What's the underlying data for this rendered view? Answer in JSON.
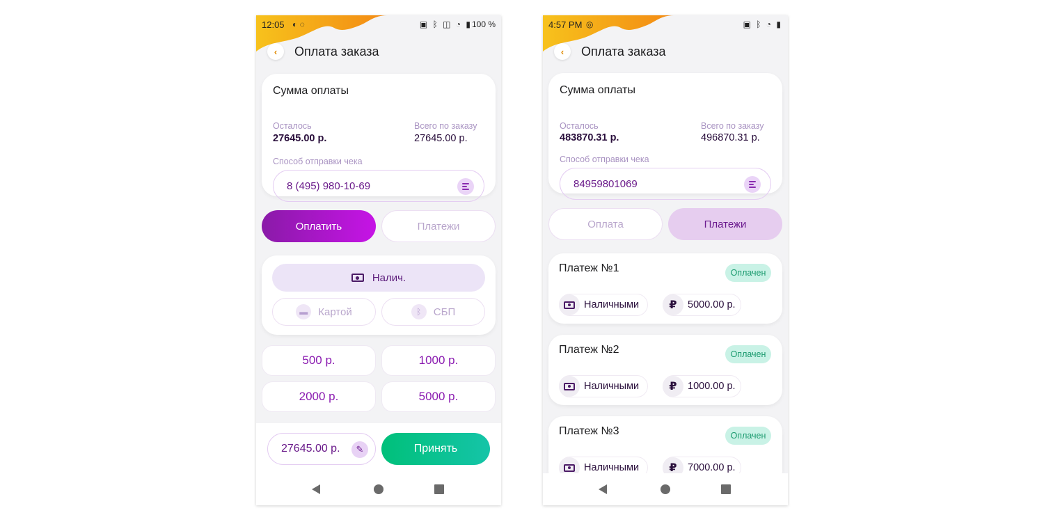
{
  "colors": {
    "accent_purple": "#8a1aa8",
    "accent_orange": "#f49b12",
    "accent_green": "#00c07a",
    "status_paid_bg": "#c9f2e6"
  },
  "left": {
    "status": {
      "time": "12:05",
      "battery": "100 %"
    },
    "title": "Оплата заказа",
    "sum": {
      "title": "Сумма оплаты",
      "remaining_label": "Осталось",
      "remaining_value": "27645.00 р.",
      "total_label": "Всего по заказу",
      "total_value": "27645.00 р.",
      "receipt_label": "Способ отправки чека",
      "receipt_value": "8 (495) 980-10-69"
    },
    "tabs": {
      "pay": "Оплатить",
      "payments": "Платежи"
    },
    "methods": {
      "cash": "Налич.",
      "card": "Картой",
      "sbp": "СБП"
    },
    "amounts": [
      "500 р.",
      "1000 р.",
      "2000 р.",
      "5000 р."
    ],
    "total_input": "27645.00 р.",
    "accept": "Принять"
  },
  "right": {
    "status": {
      "time": "4:57 PM"
    },
    "title": "Оплата заказа",
    "sum": {
      "title": "Сумма оплаты",
      "remaining_label": "Осталось",
      "remaining_value": "483870.31 р.",
      "total_label": "Всего по заказу",
      "total_value": "496870.31 р.",
      "receipt_label": "Способ отправки чека",
      "receipt_value": "84959801069"
    },
    "tabs": {
      "pay": "Оплата",
      "payments": "Платежи"
    },
    "payments": [
      {
        "title": "Платеж №1",
        "status": "Оплачен",
        "method": "Наличными",
        "currency": "₽",
        "amount": "5000.00 р."
      },
      {
        "title": "Платеж №2",
        "status": "Оплачен",
        "method": "Наличными",
        "currency": "₽",
        "amount": "1000.00 р."
      },
      {
        "title": "Платеж №3",
        "status": "Оплачен",
        "method": "Наличными",
        "currency": "₽",
        "amount": "7000.00 р."
      }
    ]
  }
}
